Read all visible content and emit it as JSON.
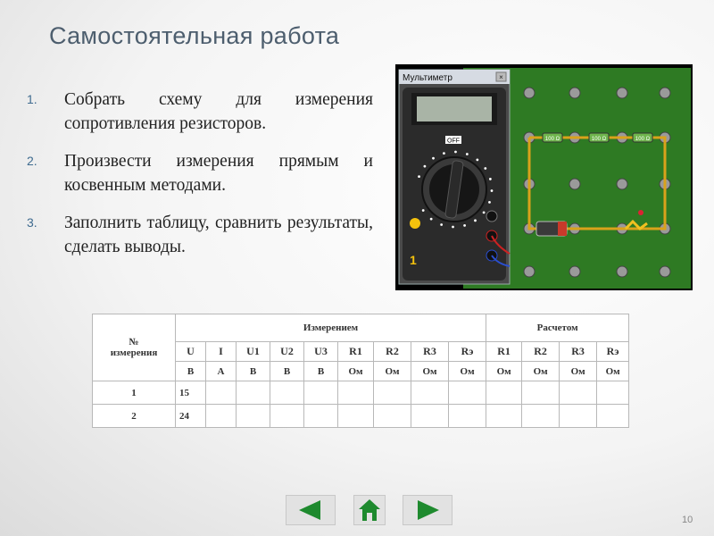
{
  "slide": {
    "title": "Самостоятельная работа",
    "page_number": "10"
  },
  "tasks": [
    {
      "num": "1.",
      "text": "Собрать схему для измерения сопротивления резисторов."
    },
    {
      "num": "2.",
      "text": "Произвести измерения прямым и косвенным методами."
    },
    {
      "num": "3.",
      "text": "Заполнить таблицу, сравнить результаты, сделать выводы."
    }
  ],
  "multimeter": {
    "window_title": "Мультиметр",
    "close_glyph": "×",
    "off_label": "OFF",
    "channel": "1",
    "resistor_labels": [
      "100 Ω",
      "100 Ω",
      "100 Ω"
    ],
    "colors": {
      "board": "#2e7a23",
      "body": "#2b2b2b",
      "display": "#a9b4a6"
    }
  },
  "table": {
    "header_no_line1": "№",
    "header_no_line2": "измерения",
    "group_measured": "Измерением",
    "group_calc": "Расчетом",
    "quantities": [
      "U",
      "I",
      "U1",
      "U2",
      "U3",
      "R1",
      "R2",
      "R3",
      "Rэ",
      "R1",
      "R2",
      "R3",
      "Rэ"
    ],
    "units": [
      "В",
      "А",
      "В",
      "В",
      "В",
      "Ом",
      "Ом",
      "Ом",
      "Ом",
      "Ом",
      "Ом",
      "Ом",
      "Ом"
    ],
    "rows": [
      {
        "n": "1",
        "u": "15"
      },
      {
        "n": "2",
        "u": "24"
      }
    ]
  },
  "navigation": {
    "colors": {
      "arrow": "#1e8a2e",
      "frame": "#e2e2e2"
    }
  }
}
